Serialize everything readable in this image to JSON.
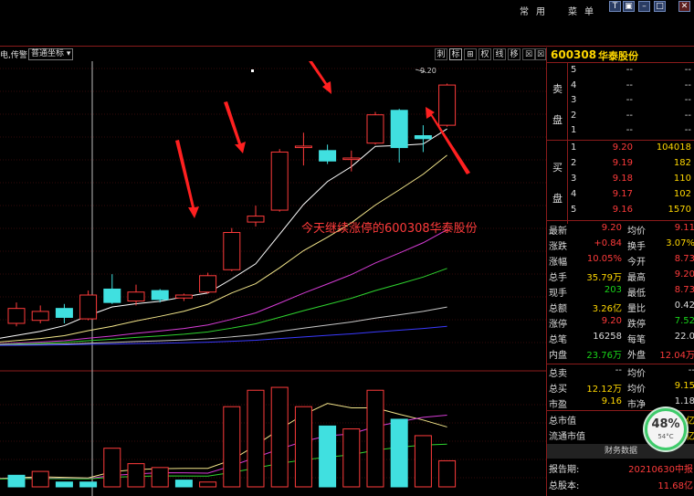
{
  "menu": {
    "item1": "常用",
    "item2": "菜单"
  },
  "window": {
    "b1": "T",
    "b2": "▣",
    "b3": "–",
    "b4": "□",
    "b5": "✕"
  },
  "toolbar": {
    "left_text": "电,传警",
    "coord_select": "普通坐标",
    "buttons": [
      "刺",
      "标",
      "⊞",
      "权",
      "线",
      "移",
      "☒",
      "☒"
    ]
  },
  "chart": {
    "price_label": "9.20",
    "annotation": "今天继续涨停的600308华泰股份"
  },
  "stock": {
    "code": "600308",
    "name": "华泰股份"
  },
  "orderbook": {
    "sell_label": [
      "卖",
      "盘"
    ],
    "buy_label": [
      "买",
      "盘"
    ],
    "sell": [
      {
        "level": "5",
        "price": "--",
        "vol": "--"
      },
      {
        "level": "4",
        "price": "--",
        "vol": "--"
      },
      {
        "level": "3",
        "price": "--",
        "vol": "--"
      },
      {
        "level": "2",
        "price": "--",
        "vol": "--"
      },
      {
        "level": "1",
        "price": "--",
        "vol": "--"
      }
    ],
    "buy": [
      {
        "level": "1",
        "price": "9.20",
        "vol": "104018"
      },
      {
        "level": "2",
        "price": "9.19",
        "vol": "182"
      },
      {
        "level": "3",
        "price": "9.18",
        "vol": "110"
      },
      {
        "level": "4",
        "price": "9.17",
        "vol": "102"
      },
      {
        "level": "5",
        "price": "9.16",
        "vol": "1570"
      }
    ]
  },
  "quote": [
    {
      "k1": "最新",
      "v1": "9.20",
      "c1": "red",
      "k2": "均价",
      "v2": "9.11",
      "c2": "red"
    },
    {
      "k1": "涨跌",
      "v1": "+0.84",
      "c1": "red",
      "k2": "换手",
      "v2": "3.07%",
      "c2": "yellow"
    },
    {
      "k1": "涨幅",
      "v1": "10.05%",
      "c1": "red",
      "k2": "今开",
      "v2": "8.73",
      "c2": "red"
    },
    {
      "k1": "总手",
      "v1": "35.79万",
      "c1": "yellow",
      "k2": "最高",
      "v2": "9.20",
      "c2": "red"
    },
    {
      "k1": "现手",
      "v1": "203",
      "c1": "green",
      "k2": "最低",
      "v2": "8.73",
      "c2": "red"
    },
    {
      "k1": "总额",
      "v1": "3.26亿",
      "c1": "yellow",
      "k2": "量比",
      "v2": "0.42",
      "c2": "white"
    },
    {
      "k1": "涨停",
      "v1": "9.20",
      "c1": "red",
      "k2": "跌停",
      "v2": "7.52",
      "c2": "green"
    },
    {
      "k1": "总笔",
      "v1": "16258",
      "c1": "white",
      "k2": "每笔",
      "v2": "22.0",
      "c2": "white"
    },
    {
      "k1": "内盘",
      "v1": "23.76万",
      "c1": "green",
      "k2": "外盘",
      "v2": "12.04万",
      "c2": "red"
    },
    {
      "k1": "总卖",
      "v1": "--",
      "c1": "white",
      "k2": "均价",
      "v2": "--",
      "c2": "white"
    },
    {
      "k1": "总买",
      "v1": "12.12万",
      "c1": "yellow",
      "k2": "均价",
      "v2": "9.15",
      "c2": "yellow"
    },
    {
      "k1": "市盈",
      "v1": "9.16",
      "c1": "yellow",
      "k2": "市净",
      "v2": "1.18",
      "c2": "white"
    },
    {
      "k1": "总市值",
      "v1": "",
      "c1": "white",
      "k2": "",
      "v2": "2亿",
      "c2": "yellow"
    },
    {
      "k1": "流通市值",
      "v1": "",
      "c1": "white",
      "k2": "",
      "v2": "亿",
      "c2": "yellow"
    }
  ],
  "fin": {
    "title": "财务数据",
    "rows": [
      {
        "k": "报告期:",
        "v": "20210630中报"
      },
      {
        "k": "总股本:",
        "v": "11.68亿"
      }
    ]
  },
  "gauge": {
    "pct": "48%",
    "temp": "54°C"
  },
  "colors": {
    "up": "#ff3b3b",
    "down": "#40e0e0",
    "panel_border": "#8b1b1b",
    "ma5": "#ffffff",
    "ma10": "#f2e58a",
    "ma20": "#d63cd6",
    "ma30": "#2fd42f",
    "ma60": "#c8c8c8",
    "ma120": "#3a3aff"
  },
  "chart_data": {
    "type": "candlestick",
    "candles": [
      {
        "o": 7.6,
        "c": 7.7,
        "h": 7.74,
        "l": 7.58
      },
      {
        "o": 7.62,
        "c": 7.68,
        "h": 7.72,
        "l": 7.6
      },
      {
        "o": 7.7,
        "c": 7.64,
        "h": 7.73,
        "l": 7.6
      },
      {
        "o": 7.63,
        "c": 7.79,
        "h": 7.82,
        "l": 7.62
      },
      {
        "o": 7.83,
        "c": 7.74,
        "h": 7.93,
        "l": 7.73
      },
      {
        "o": 7.75,
        "c": 7.81,
        "h": 7.86,
        "l": 7.72
      },
      {
        "o": 7.82,
        "c": 7.76,
        "h": 7.83,
        "l": 7.74
      },
      {
        "o": 7.77,
        "c": 7.79,
        "h": 7.8,
        "l": 7.75
      },
      {
        "o": 7.81,
        "c": 7.92,
        "h": 7.94,
        "l": 7.8
      },
      {
        "o": 7.96,
        "c": 8.21,
        "h": 8.24,
        "l": 7.95
      },
      {
        "o": 8.28,
        "c": 8.32,
        "h": 8.39,
        "l": 8.25
      },
      {
        "o": 8.36,
        "c": 8.75,
        "h": 8.77,
        "l": 8.35
      },
      {
        "o": 8.78,
        "c": 8.79,
        "h": 8.88,
        "l": 8.66
      },
      {
        "o": 8.76,
        "c": 8.69,
        "h": 8.8,
        "l": 8.67
      },
      {
        "o": 8.7,
        "c": 8.71,
        "h": 8.76,
        "l": 8.62
      },
      {
        "o": 8.81,
        "c": 9.0,
        "h": 9.02,
        "l": 8.8
      },
      {
        "o": 9.03,
        "c": 8.78,
        "h": 9.04,
        "l": 8.68
      },
      {
        "o": 8.86,
        "c": 8.84,
        "h": 8.93,
        "l": 8.75
      },
      {
        "o": 8.93,
        "c": 9.2,
        "h": 9.21,
        "l": 8.92
      }
    ],
    "volume": [
      12,
      16,
      5,
      5,
      40,
      24,
      20,
      7,
      5,
      83,
      100,
      103,
      83,
      63,
      60,
      100,
      70,
      53,
      27
    ],
    "volume_up": [
      false,
      true,
      false,
      false,
      true,
      true,
      true,
      false,
      true,
      true,
      true,
      true,
      true,
      false,
      true,
      true,
      false,
      true,
      true
    ]
  }
}
